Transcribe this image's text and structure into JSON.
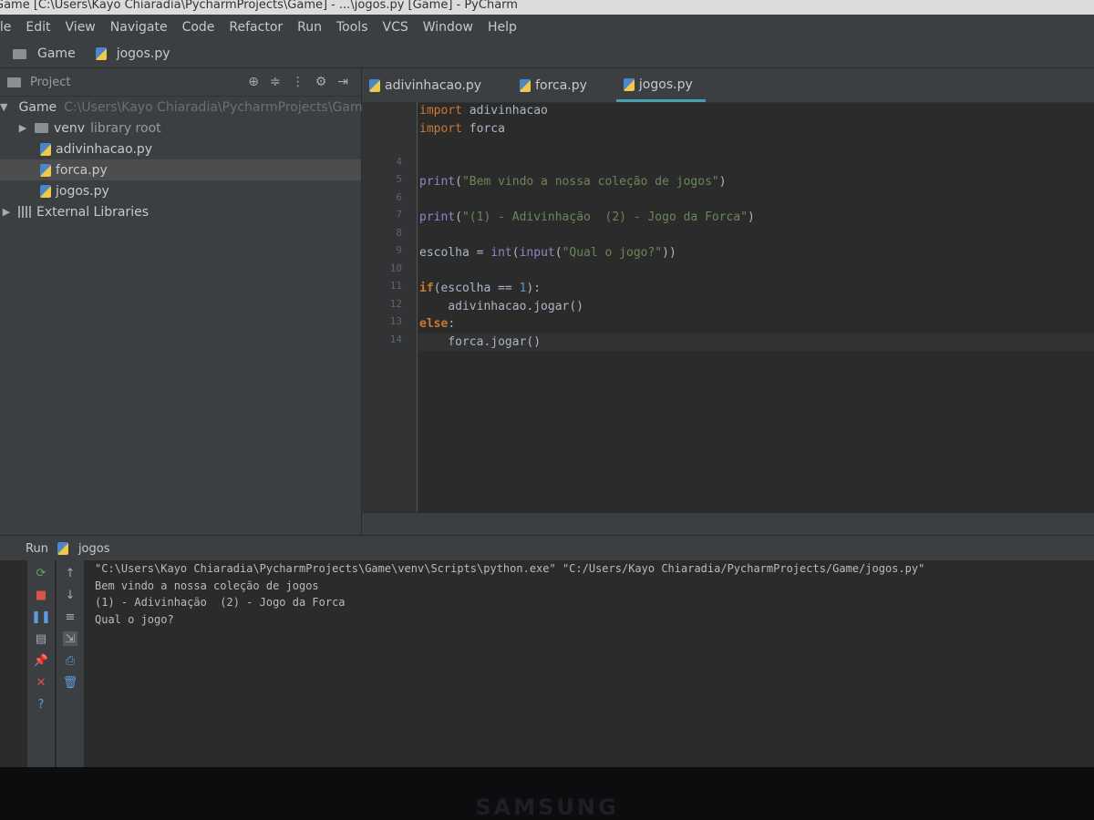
{
  "window": {
    "title": "Game [C:\\Users\\Kayo Chiaradia\\PycharmProjects\\Game] - ...\\jogos.py [Game] - PyCharm"
  },
  "menu": [
    "ile",
    "Edit",
    "View",
    "Navigate",
    "Code",
    "Refactor",
    "Run",
    "Tools",
    "VCS",
    "Window",
    "Help"
  ],
  "navbar": {
    "project": "Game",
    "file": "jogos.py"
  },
  "project_panel": {
    "title": "Project",
    "root": {
      "name": "Game",
      "path": "C:\\Users\\Kayo Chiaradia\\PycharmProjects\\Game"
    },
    "items": [
      {
        "name": "venv",
        "note": "library root"
      },
      {
        "name": "adivinhacao.py"
      },
      {
        "name": "forca.py"
      },
      {
        "name": "jogos.py"
      }
    ],
    "external": "External Libraries"
  },
  "editor": {
    "tabs": [
      "adivinhacao.py",
      "forca.py",
      "jogos.py"
    ],
    "active_tab": "jogos.py",
    "line_numbers": [
      "",
      "",
      "",
      "4",
      "5",
      "6",
      "7",
      "8",
      "9",
      "10",
      "11",
      "12",
      "13",
      "14"
    ],
    "code": {
      "l1_kw": "import",
      "l1_rest": " adivinhacao",
      "l2_kw": "import",
      "l2_rest": " forca",
      "l5_fn": "print",
      "l5_a": "(",
      "l5_str": "\"Bem vindo a nossa coleção de jogos\"",
      "l5_b": ")",
      "l7_fn": "print",
      "l7_a": "(",
      "l7_str": "\"(1) - Adivinhação  (2) - Jogo da Forca\"",
      "l7_b": ")",
      "l9_a": "escolha = ",
      "l9_fn1": "int",
      "l9_b": "(",
      "l9_fn2": "input",
      "l9_c": "(",
      "l9_str": "\"Qual o jogo?\"",
      "l9_d": "))",
      "l11_kw": "if",
      "l11_a": "(escolha == ",
      "l11_num": "1",
      "l11_b": "):",
      "l12": "    adivinhacao.jogar()",
      "l13_kw": "else",
      "l13_a": ":",
      "l14": "    forca.jogar()"
    }
  },
  "run_panel": {
    "label": "Run",
    "config": "jogos",
    "output": [
      "\"C:\\Users\\Kayo Chiaradia\\PycharmProjects\\Game\\venv\\Scripts\\python.exe\" \"C:/Users/Kayo Chiaradia/PycharmProjects/Game/jogos.py\"",
      "Bem vindo a nossa coleção de jogos",
      "(1) - Adivinhação  (2) - Jogo da Forca",
      "Qual o jogo?"
    ]
  },
  "monitor_brand": "SAMSUNG",
  "colors": {
    "accent": "#4a9fb0",
    "keyword": "#cc7832",
    "string": "#6a8759",
    "builtin": "#8888c6",
    "number": "#6897bb"
  }
}
